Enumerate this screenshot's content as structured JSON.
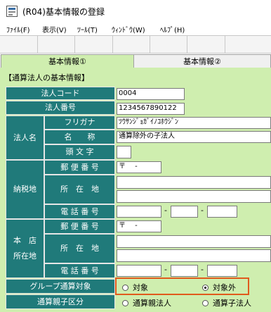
{
  "window": {
    "title": "(R04)基本情報の登録"
  },
  "menu": {
    "file": "ﾌｧｲﾙ(F)",
    "view": "表示(V)",
    "tool": "ﾂｰﾙ(T)",
    "window": "ｳｨﾝﾄﾞｳ(W)",
    "help": "ﾍﾙﾌﾟ(H)"
  },
  "tabs": [
    {
      "label": "基本情報①"
    },
    {
      "label": "基本情報②"
    }
  ],
  "section_title": "【通算法人の基本情報】",
  "labels": {
    "corp_code": "法人コード",
    "corp_number": "法人番号",
    "corp_name": "法人名",
    "furigana": "フリガナ",
    "name": "名　　称",
    "head_char": "頭 文 字",
    "tax_place": "納税地",
    "postal": "郵 便 番 号",
    "address": "所　在　地",
    "phone": "電 話 番 号",
    "head_office_1": "本　店",
    "head_office_2": "所在地",
    "postal2": "郵 便 番 号",
    "address2": "所　在　地",
    "phone2": "電 話 番 号",
    "group_target": "グループ通算対象",
    "parent_child": "通算親子区分"
  },
  "values": {
    "corp_code": "0004",
    "corp_number": "1234567890122",
    "furigana": "ﾂｳｻﾝｼﾞｮｶﾞｲﾉｺﾎｳｼﾞﾝ",
    "name": "通算除外の子法人",
    "head_char": "",
    "postal1": "〒　 -",
    "postal2": "〒　 -",
    "dash": "-"
  },
  "radios": {
    "target": "対象",
    "non_target": "対象外",
    "parent": "通算親法人",
    "child": "通算子法人"
  }
}
